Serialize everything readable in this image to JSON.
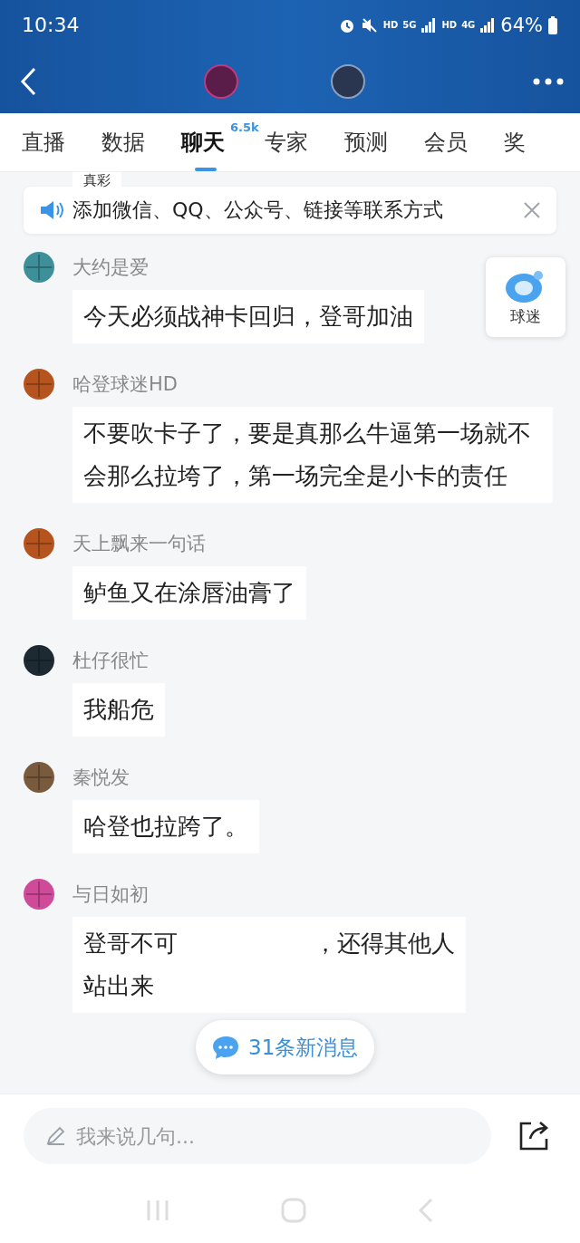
{
  "status_bar": {
    "time": "10:34",
    "network_1": "HD",
    "network_2": "5G",
    "network_3": "HD",
    "network_4": "4G",
    "battery": "64%"
  },
  "tabs": [
    {
      "label": "直播",
      "selected": false
    },
    {
      "label": "数据",
      "selected": false
    },
    {
      "label": "聊天",
      "selected": true,
      "badge": "6.5k"
    },
    {
      "label": "专家",
      "selected": false
    },
    {
      "label": "预测",
      "selected": false
    },
    {
      "label": "会员",
      "selected": false
    },
    {
      "label": "奖",
      "selected": false
    }
  ],
  "partial_message": "真彩",
  "notice": {
    "text": "添加微信、QQ、公众号、链接等联系方式"
  },
  "fan_button": {
    "label": "球迷"
  },
  "messages": [
    {
      "name": "大约是爱",
      "text": "今天必须战神卡回归，登哥加油"
    },
    {
      "name": "哈登球迷HD",
      "text": "不要吹卡子了，要是真那么牛逼第一场就不会那么拉垮了，第一场完全是小卡的责任"
    },
    {
      "name": "天上飘来一句话",
      "text": "鲈鱼又在涂唇油膏了"
    },
    {
      "name": "杜仔很忙",
      "text": "我船危"
    },
    {
      "name": "秦悦发",
      "text": "哈登也拉跨了。"
    },
    {
      "name": "与日如初",
      "fragments": [
        "登哥不可",
        "，还得其他人",
        "站出来"
      ]
    }
  ],
  "new_messages": {
    "label": "31条新消息"
  },
  "input": {
    "placeholder": "我来说几句..."
  }
}
